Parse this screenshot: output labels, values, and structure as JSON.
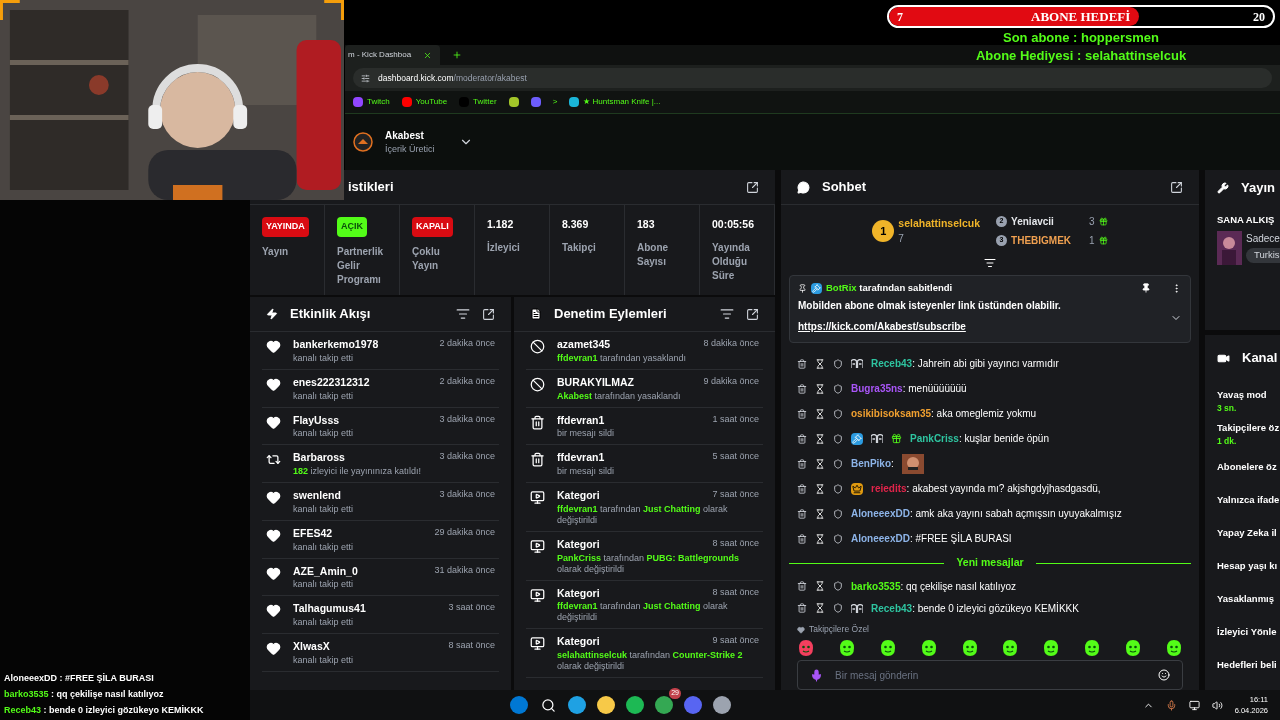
{
  "overlay": {
    "goal": {
      "current": "7",
      "title": "ABONE HEDEFİ",
      "target": "20",
      "level": 0.65
    },
    "lines": [
      "Son abone : hoppersmen",
      "Abone Hediyesi : selahattinselcuk"
    ],
    "chat": [
      {
        "user": "AloneeexDD",
        "color": "#ffffff",
        "text": " : #FREE ŞİLA BURASI"
      },
      {
        "user": "barko3535",
        "color": "#53fc18",
        "text": " : qq çekilişe nasıl katılıyoz"
      },
      {
        "user": "Receb43",
        "color": "#53fc18",
        "text": " : bende 0 izleyici gözükeyo KEMİKKK"
      }
    ]
  },
  "browser": {
    "tab": "m - Kick Dashboa",
    "url_host": "dashboard.kick.com",
    "url_path": "/moderator/akabest",
    "bookmarks": [
      {
        "kind": "twitch",
        "label": "Twitch"
      },
      {
        "kind": "youtube",
        "label": "YouTube"
      },
      {
        "kind": "x",
        "label": "Twitter"
      },
      {
        "kind": "p"
      },
      {
        "kind": "swirl"
      },
      {
        "kind": "chevron",
        "label": ">"
      },
      {
        "kind": "app",
        "label": "★ Huntsman Knife |..."
      }
    ]
  },
  "header": {
    "name": "Akabest",
    "role": "İçerik Üretici"
  },
  "stats": {
    "title": "istikleri",
    "items": [
      {
        "kind": "badge",
        "badge": "YAYINDA",
        "color": "#d90b12",
        "label": "Yayın"
      },
      {
        "kind": "badge",
        "badge": "AÇIK",
        "color": "#53fc18",
        "label": "Partnerlik Gelir Programı"
      },
      {
        "kind": "badge",
        "badge": "KAPALI",
        "color": "#d90b12",
        "label": "Çoklu Yayın"
      },
      {
        "kind": "number",
        "value": "1.182",
        "label": "İzleyici"
      },
      {
        "kind": "number",
        "value": "8.369",
        "label": "Takipçi"
      },
      {
        "kind": "number",
        "value": "183",
        "label": "Abone Sayısı"
      },
      {
        "kind": "number",
        "value": "00:05:56",
        "label": "Yayında Olduğu Süre"
      }
    ]
  },
  "activity": {
    "title": "Etkinlik Akışı",
    "items": [
      {
        "kind": "follow",
        "name": "bankerkemo1978",
        "time": "2 dakika önce",
        "detail": [
          {
            "text": "kanalı takip etti",
            "highlight": false
          }
        ]
      },
      {
        "kind": "follow",
        "name": "enes222312312",
        "time": "2 dakika önce",
        "detail": [
          {
            "text": "kanalı takip etti",
            "highlight": false
          }
        ]
      },
      {
        "kind": "follow",
        "name": "FlayUsss",
        "time": "3 dakika önce",
        "detail": [
          {
            "text": "kanalı takip etti",
            "highlight": false
          }
        ]
      },
      {
        "kind": "host",
        "name": "Barbaross",
        "time": "3 dakika önce",
        "detail": [
          {
            "text": "182",
            "highlight": true
          },
          {
            "text": " izleyici ile yayınınıza katıldı!",
            "highlight": false
          }
        ]
      },
      {
        "kind": "follow",
        "name": "swenlend",
        "time": "3 dakika önce",
        "detail": [
          {
            "text": "kanalı takip etti",
            "highlight": false
          }
        ]
      },
      {
        "kind": "follow",
        "name": "EFES42",
        "time": "29 dakika önce",
        "detail": [
          {
            "text": "kanalı takip etti",
            "highlight": false
          }
        ]
      },
      {
        "kind": "follow",
        "name": "AZE_Amin_0",
        "time": "31 dakika önce",
        "detail": [
          {
            "text": "kanalı takip etti",
            "highlight": false
          }
        ]
      },
      {
        "kind": "follow",
        "name": "Talhagumus41",
        "time": "3 saat önce",
        "detail": [
          {
            "text": "kanalı takip etti",
            "highlight": false
          }
        ]
      },
      {
        "kind": "follow",
        "name": "XlwasX",
        "time": "8 saat önce",
        "detail": [
          {
            "text": "kanalı takip etti",
            "highlight": false
          }
        ]
      }
    ]
  },
  "moderation": {
    "title": "Denetim Eylemleri",
    "items": [
      {
        "kind": "ban",
        "name": "azamet345",
        "time": "8 dakika önce",
        "detail": [
          {
            "text": "ffdevran1",
            "highlight": true
          },
          {
            "text": " tarafından yasaklandı",
            "highlight": false
          }
        ]
      },
      {
        "kind": "ban",
        "name": "BURAKYILMAZ",
        "time": "9 dakika önce",
        "detail": [
          {
            "text": "Akabest",
            "highlight": true
          },
          {
            "text": " tarafından yasaklandı",
            "highlight": false
          }
        ]
      },
      {
        "kind": "delete",
        "name": "ffdevran1",
        "time": "1 saat önce",
        "detail": [
          {
            "text": "bir mesajı sildi",
            "highlight": false
          }
        ]
      },
      {
        "kind": "delete",
        "name": "ffdevran1",
        "time": "5 saat önce",
        "detail": [
          {
            "text": "bir mesajı sildi",
            "highlight": false
          }
        ]
      },
      {
        "kind": "category",
        "name": "Kategori",
        "time": "7 saat önce",
        "detail": [
          {
            "text": "ffdevran1",
            "highlight": true
          },
          {
            "text": " tarafından ",
            "highlight": false
          },
          {
            "text": "Just Chatting",
            "highlight": true
          },
          {
            "text": " olarak değiştirildi",
            "highlight": false
          }
        ]
      },
      {
        "kind": "category",
        "name": "Kategori",
        "time": "8 saat önce",
        "detail": [
          {
            "text": "PankCriss",
            "highlight": true
          },
          {
            "text": " tarafından ",
            "highlight": false
          },
          {
            "text": "PUBG: Battlegrounds",
            "highlight": true
          },
          {
            "text": " olarak değiştirildi",
            "highlight": false
          }
        ]
      },
      {
        "kind": "category",
        "name": "Kategori",
        "time": "8 saat önce",
        "detail": [
          {
            "text": "ffdevran1",
            "highlight": true
          },
          {
            "text": " tarafından ",
            "highlight": false
          },
          {
            "text": "Just Chatting",
            "highlight": true
          },
          {
            "text": " olarak değiştirildi",
            "highlight": false
          }
        ]
      },
      {
        "kind": "category",
        "name": "Kategori",
        "time": "9 saat önce",
        "detail": [
          {
            "text": "selahattinselcuk",
            "highlight": true
          },
          {
            "text": " tarafından ",
            "highlight": false
          },
          {
            "text": "Counter-Strike 2",
            "highlight": true
          },
          {
            "text": " olarak değiştirildi",
            "highlight": false
          }
        ]
      }
    ]
  },
  "chat": {
    "title": "Sohbet",
    "leaders": [
      {
        "rank": "1",
        "name": "selahattinselcuk",
        "count": "7",
        "color": "#f0b429"
      },
      {
        "rank": "2",
        "name": "Yeniavcii",
        "count": "3",
        "color": "#e5e7eb"
      },
      {
        "rank": "3",
        "name": "THEBIGMEK",
        "count": "1",
        "color": "#f0a050"
      }
    ],
    "pinned": {
      "by": "BotRix",
      "by_suffix": " tarafından sabitlendi",
      "message": "Mobilden abone olmak isteyenler link üstünden olabilir.",
      "link": "https://kick.com/Akabest/subscribe"
    },
    "messages": [
      {
        "user": "Receb43",
        "color": "#2ec4a0",
        "badges": [
          {
            "kind": "og"
          }
        ],
        "text": ": Jahrein abi gibi yayıncı varmıdır"
      },
      {
        "user": "Bugra35ns",
        "color": "#a855f7",
        "text": ": menüüüüüüü"
      },
      {
        "user": "osikibisoksam35",
        "color": "#f0a030",
        "text": ": aka omeglemiz yokmu"
      },
      {
        "user": "PankCriss",
        "color": "#2ec4a0",
        "badges": [
          {
            "kind": "moderator"
          },
          {
            "kind": "og"
          },
          {
            "kind": "gifter"
          }
        ],
        "text": ": kuşlar benide öpün"
      },
      {
        "user": "BenPiko",
        "color": "#8db4e8",
        "text": ":",
        "emote": true
      },
      {
        "user": "reiedits",
        "color": "#e0244a",
        "badges": [
          {
            "kind": "crown"
          }
        ],
        "text": ": akabest yayında mı? akjshgdyjhasdgasdü,"
      },
      {
        "user": "AloneeexDD",
        "color": "#8db4e8",
        "text": ": amk aka yayını sabah açmışsın uyuyakalmışız"
      },
      {
        "user": "AloneeexDD",
        "color": "#8db4e8",
        "text": ": #FREE ŞİLA BURASI"
      }
    ],
    "new_label": "Yeni mesajlar",
    "new_messages": [
      {
        "user": "barko3535",
        "color": "#53fc18",
        "text": ": qq çekilişe nasıl katılıyoz"
      },
      {
        "user": "Receb43",
        "color": "#2ec4a0",
        "badges": [
          {
            "kind": "og"
          }
        ],
        "text": ": bende 0 izleyici gözükeyo KEMİKKK"
      }
    ],
    "emotes_label": "Takipçilere Özel",
    "placeholder": "Bir mesaj gönderin"
  },
  "stream_info": {
    "title": "Yayın",
    "stream_title": "SANA ALKIŞ",
    "line": "Sadece",
    "tag": "Turkis"
  },
  "channel": {
    "title": "Kanal",
    "settings": [
      {
        "label": "Yavaş mod",
        "value": "3 sn."
      },
      {
        "label": "Takipçilere öz",
        "value": "1 dk."
      },
      {
        "label": "Abonelere öz"
      },
      {
        "label": "Yalnızca ifade"
      },
      {
        "label": "Yapay Zeka il"
      },
      {
        "label": "Hesap yaşı kı"
      },
      {
        "label": "Yasaklanmış"
      },
      {
        "label": "İzleyici Yönle"
      },
      {
        "label": "Hedefleri beli"
      }
    ]
  },
  "taskbar": {
    "chrome_badge": "29",
    "time": "16:11",
    "date": "6.04.2026"
  }
}
